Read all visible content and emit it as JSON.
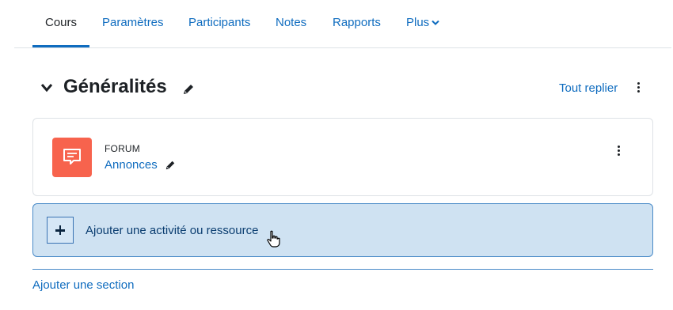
{
  "nav": {
    "tabs": [
      {
        "label": "Cours",
        "active": true
      },
      {
        "label": "Paramètres",
        "active": false
      },
      {
        "label": "Participants",
        "active": false
      },
      {
        "label": "Notes",
        "active": false
      },
      {
        "label": "Rapports",
        "active": false
      },
      {
        "label": "Plus",
        "active": false,
        "has_dropdown": true
      }
    ]
  },
  "section": {
    "title": "Généralités",
    "collapse_all_label": "Tout replier",
    "toggle_icon": "chevron-down-icon",
    "edit_icon": "pencil-icon",
    "menu_icon": "kebab-menu-icon"
  },
  "activity": {
    "type_label": "FORUM",
    "name": "Annonces",
    "icon": "forum-icon",
    "icon_color": "#f7634d",
    "edit_icon": "pencil-icon",
    "menu_icon": "kebab-menu-icon"
  },
  "add_activity": {
    "label": "Ajouter une activité ou ressource",
    "icon": "plus-icon",
    "background": "#cfe2f2"
  },
  "add_section_label": "Ajouter une section",
  "colors": {
    "link": "#0f6cbf",
    "text": "#1d2125",
    "accent": "#0f6cbf"
  }
}
